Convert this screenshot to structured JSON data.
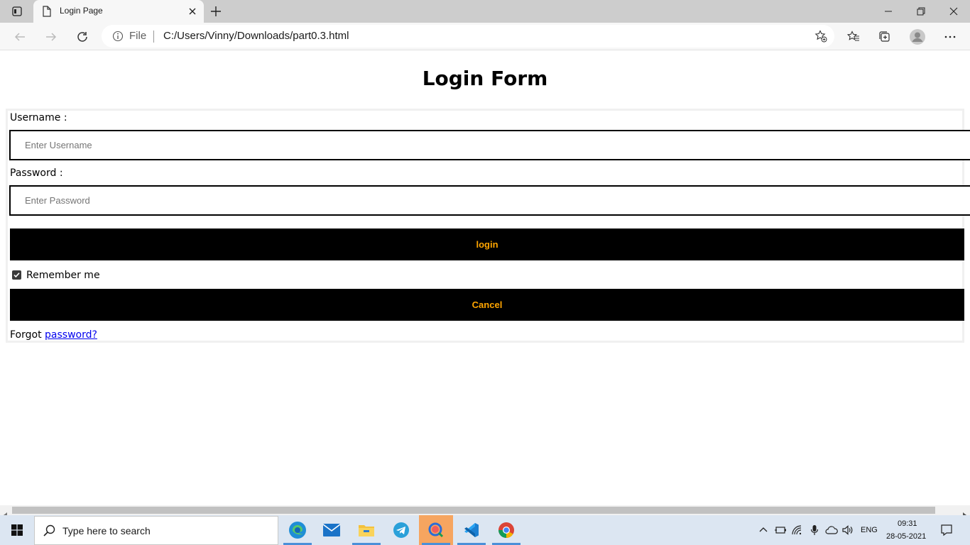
{
  "browser": {
    "tab_title": "Login Page",
    "address_scheme_label": "File",
    "url": "C:/Users/Vinny/Downloads/part0.3.html"
  },
  "page": {
    "title": "Login Form",
    "username_label": "Username :",
    "username_placeholder": "Enter Username",
    "password_label": "Password :",
    "password_placeholder": "Enter Password",
    "login_button": "login",
    "remember_label": "Remember me",
    "remember_checked": true,
    "cancel_button": "Cancel",
    "forgot_prefix": "Forgot",
    "forgot_link": "password?",
    "button_text_color": "#ffa500"
  },
  "taskbar": {
    "search_placeholder": "Type here to search",
    "language": "ENG",
    "time": "09:31",
    "date": "28-05-2021",
    "apps": [
      "edge-icon",
      "mail-icon",
      "file-explorer-icon",
      "telegram-icon",
      "snip-icon",
      "vscode-icon",
      "chrome-icon"
    ]
  }
}
